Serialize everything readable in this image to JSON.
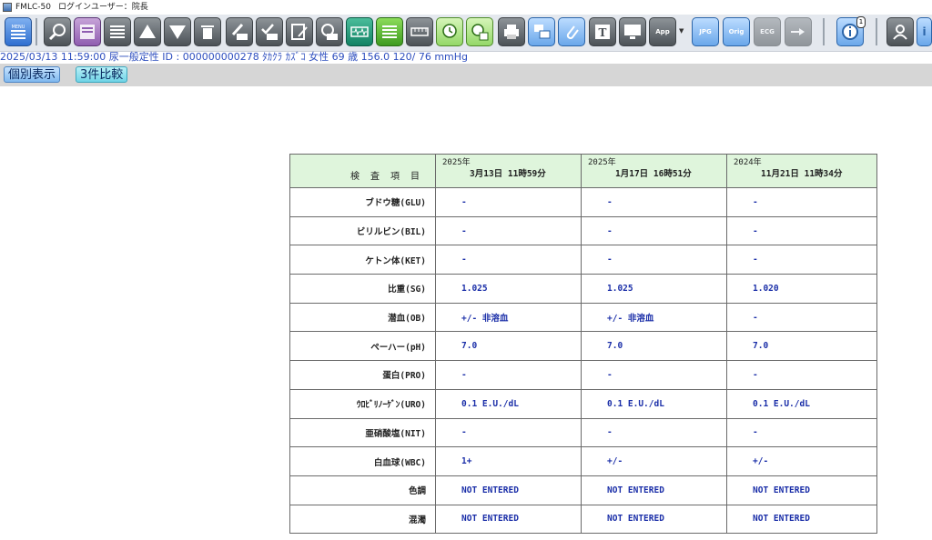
{
  "window": {
    "title": "FMLC-50",
    "login_label": "ログインユーザー：院長"
  },
  "toolbar": {
    "buttons": [
      {
        "id": "menu",
        "label": "MENU"
      },
      {
        "id": "search"
      },
      {
        "id": "view"
      },
      {
        "id": "list"
      },
      {
        "id": "up"
      },
      {
        "id": "down"
      },
      {
        "id": "delete"
      },
      {
        "id": "edit-or"
      },
      {
        "id": "check-or"
      },
      {
        "id": "memo"
      },
      {
        "id": "time-or"
      },
      {
        "id": "wave"
      },
      {
        "id": "list-green"
      },
      {
        "id": "ruler"
      },
      {
        "id": "clock-a"
      },
      {
        "id": "clock-b"
      },
      {
        "id": "print"
      },
      {
        "id": "print-send"
      },
      {
        "id": "attach"
      },
      {
        "id": "text",
        "label": "T"
      },
      {
        "id": "monitor"
      },
      {
        "id": "app",
        "label": "App"
      },
      {
        "id": "jpg",
        "label": "JPG"
      },
      {
        "id": "orig",
        "label": "Orig"
      },
      {
        "id": "ecg",
        "label": "ECG"
      },
      {
        "id": "export"
      },
      {
        "id": "info"
      },
      {
        "id": "user"
      },
      {
        "id": "help",
        "label": "i"
      }
    ],
    "info_badge": "1"
  },
  "status": {
    "text": "2025/03/13 11:59:00  尿一般定性  ID : 000000000278  ﾀｶｸﾗ ｶｽﾞｺ  女性  69  歳  156.0   120/ 76 mmHg"
  },
  "mode_buttons": {
    "individual": "個別表示",
    "compare": "3件比較"
  },
  "table": {
    "header_item": "検 査 項 目",
    "dates": [
      {
        "year": "2025年",
        "datetime": "3月13日 11時59分"
      },
      {
        "year": "2025年",
        "datetime": "1月17日 16時51分"
      },
      {
        "year": "2024年",
        "datetime": "11月21日 11時34分"
      }
    ],
    "rows": [
      {
        "item": "ブドウ糖(GLU)",
        "values": [
          "-",
          "-",
          "-"
        ]
      },
      {
        "item": "ビリルビン(BIL)",
        "values": [
          "-",
          "-",
          "-"
        ]
      },
      {
        "item": "ケトン体(KET)",
        "values": [
          "-",
          "-",
          "-"
        ]
      },
      {
        "item": "比重(SG)",
        "values": [
          "1.025",
          "1.025",
          "1.020"
        ]
      },
      {
        "item": "潜血(OB)",
        "values": [
          "+/- 非溶血",
          "+/- 非溶血",
          "-"
        ]
      },
      {
        "item": "ペーハー(pH)",
        "values": [
          "7.0",
          "7.0",
          "7.0"
        ]
      },
      {
        "item": "蛋白(PRO)",
        "values": [
          "-",
          "-",
          "-"
        ]
      },
      {
        "item": "ｳﾛﾋﾞﾘﾉｰｹﾞﾝ(URO)",
        "values": [
          "0.1 E.U./dL",
          "0.1 E.U./dL",
          "0.1 E.U./dL"
        ]
      },
      {
        "item": "亜硝酸塩(NIT)",
        "values": [
          "-",
          "-",
          "-"
        ]
      },
      {
        "item": "白血球(WBC)",
        "values": [
          "1+",
          "+/-",
          "+/-"
        ]
      },
      {
        "item": "色調",
        "values": [
          "NOT ENTERED",
          "NOT ENTERED",
          "NOT ENTERED"
        ]
      },
      {
        "item": "混濁",
        "values": [
          "NOT ENTERED",
          "NOT ENTERED",
          "NOT ENTERED"
        ]
      }
    ]
  }
}
